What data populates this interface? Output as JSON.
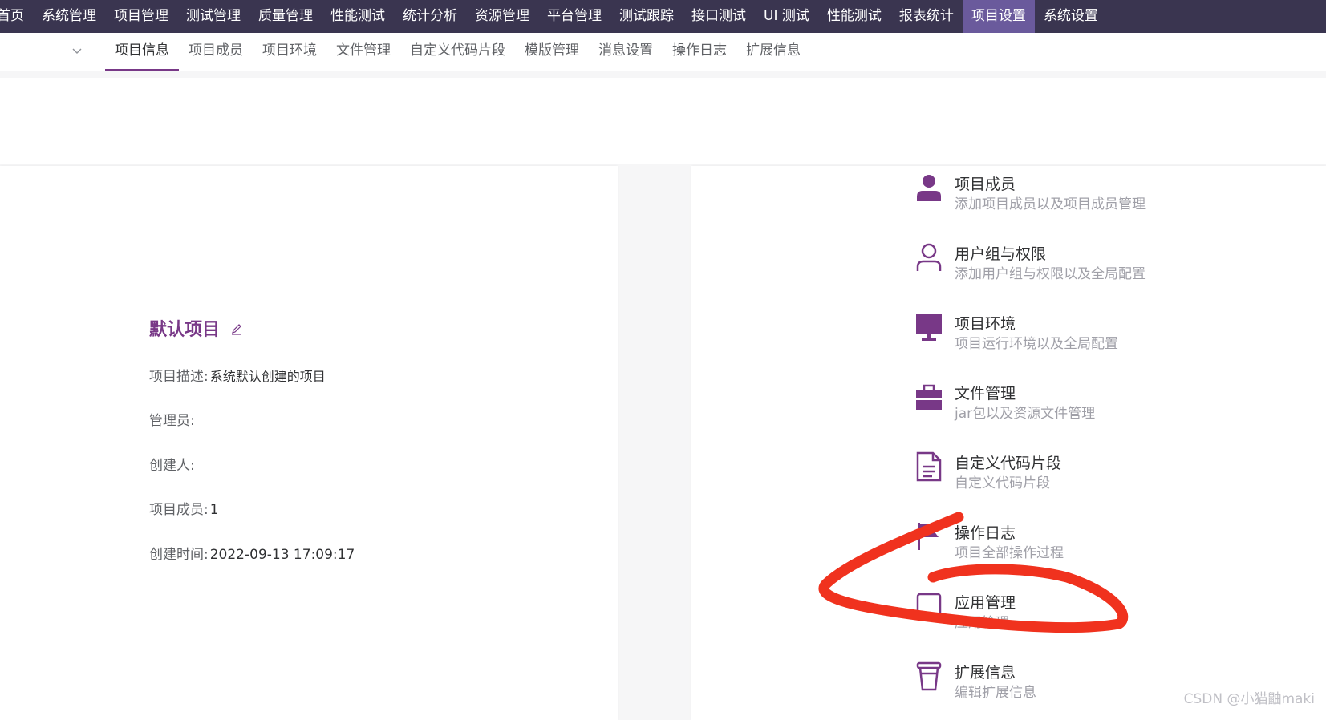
{
  "topnav": {
    "items": [
      {
        "label": "首页"
      },
      {
        "label": "系统管理"
      },
      {
        "label": "项目管理"
      },
      {
        "label": "测试管理"
      },
      {
        "label": "质量管理"
      },
      {
        "label": "性能测试"
      },
      {
        "label": "统计分析"
      },
      {
        "label": "资源管理"
      },
      {
        "label": "平台管理"
      },
      {
        "label": "测试跟踪"
      },
      {
        "label": "接口测试"
      },
      {
        "label": "UI 测试"
      },
      {
        "label": "性能测试"
      },
      {
        "label": "报表统计"
      },
      {
        "label": "项目设置",
        "active": true
      },
      {
        "label": "系统设置"
      }
    ]
  },
  "subnav": {
    "tabs": [
      {
        "label": "项目信息",
        "active": true
      },
      {
        "label": "项目成员"
      },
      {
        "label": "项目环境"
      },
      {
        "label": "文件管理"
      },
      {
        "label": "自定义代码片段"
      },
      {
        "label": "模版管理"
      },
      {
        "label": "消息设置"
      },
      {
        "label": "操作日志"
      },
      {
        "label": "扩展信息"
      }
    ]
  },
  "project": {
    "title": "默认项目",
    "description_label": "项目描述:",
    "description_value": "系统默认创建的项目",
    "admin_label": "管理员:",
    "creator_label": "创建人:",
    "members_label": "项目成员:",
    "members_value": "1",
    "created_label": "创建时间:",
    "created_value": "2022-09-13 17:09:17"
  },
  "menu": [
    {
      "title": "项目成员",
      "desc": "添加项目成员以及项目成员管理",
      "icon": "user-filled-icon"
    },
    {
      "title": "用户组与权限",
      "desc": "添加用户组与权限以及全局配置",
      "icon": "user-outline-icon"
    },
    {
      "title": "项目环境",
      "desc": "项目运行环境以及全局配置",
      "icon": "monitor-icon"
    },
    {
      "title": "文件管理",
      "desc": "jar包以及资源文件管理",
      "icon": "briefcase-icon"
    },
    {
      "title": "自定义代码片段",
      "desc": "自定义代码片段",
      "icon": "document-icon"
    },
    {
      "title": "操作日志",
      "desc": "项目全部操作过程",
      "icon": "flag-icon"
    },
    {
      "title": "应用管理",
      "desc": "应用管理",
      "icon": "app-box-icon"
    },
    {
      "title": "扩展信息",
      "desc": "编辑扩展信息",
      "icon": "cup-icon"
    }
  ],
  "colors": {
    "topnav_bg": "#3a3550",
    "topnav_active": "#6a5a9c",
    "accent": "#783887",
    "annotation": "#f0321e"
  },
  "watermark": "CSDN @小猫鼬maki"
}
